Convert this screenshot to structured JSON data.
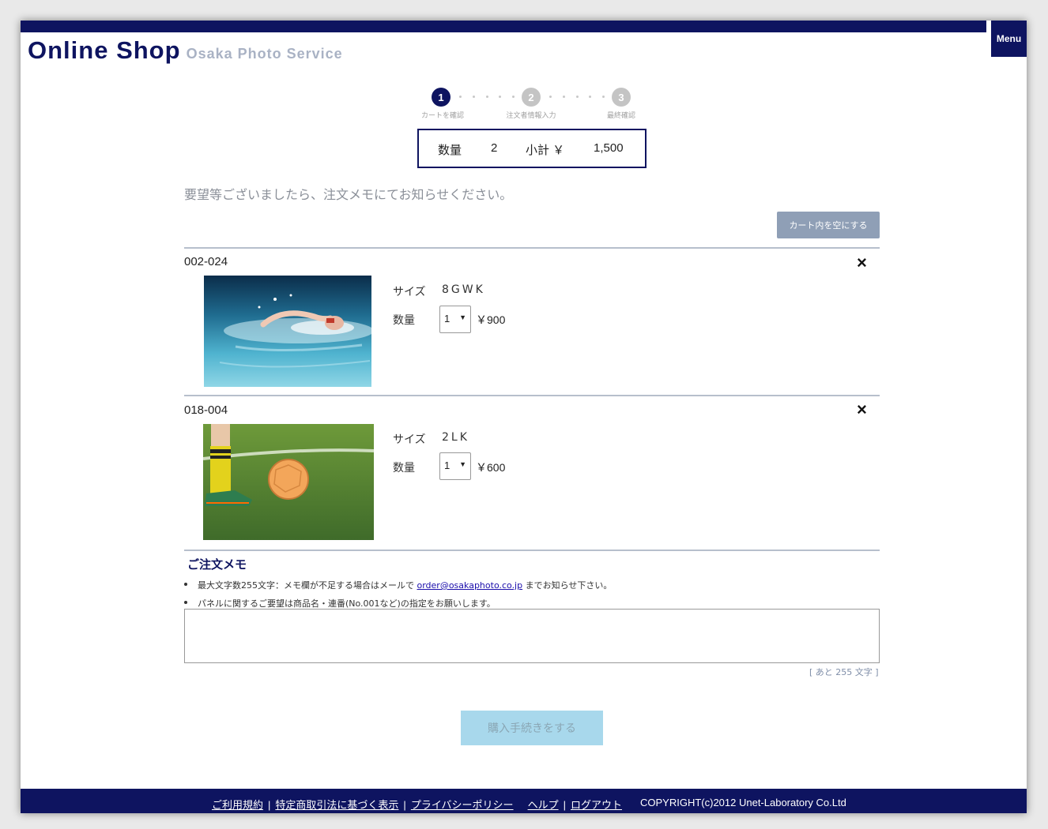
{
  "header": {
    "title": "Online Shop",
    "subtitle": "Osaka Photo Service",
    "menu_label": "Menu"
  },
  "steps": [
    {
      "number": "1",
      "label": "カートを確認",
      "active": true
    },
    {
      "number": "2",
      "label": "注文者情報入力",
      "active": false
    },
    {
      "number": "3",
      "label": "最終確認",
      "active": false
    }
  ],
  "summary": {
    "qty_label": "数量",
    "qty_value": "2",
    "subtotal_label": "小計 ￥",
    "subtotal_value": "1,500"
  },
  "notice": "要望等ございましたら、注文メモにてお知らせください。",
  "empty_cart_label": "カート内を空にする",
  "items": [
    {
      "code": "002-024",
      "size_label": "サイズ",
      "size_value": "8GWK",
      "qty_label": "数量",
      "qty_value": "1",
      "price": "￥900",
      "photo": "swimmer-photo"
    },
    {
      "code": "018-004",
      "size_label": "サイズ",
      "size_value": "2LK",
      "qty_label": "数量",
      "qty_value": "1",
      "price": "￥600",
      "photo": "soccer-ball-photo"
    }
  ],
  "remove_icon": "×",
  "memo": {
    "title": "ご注文メモ",
    "note1_pre": "最大文字数255文字：メモ欄が不足する場合はメールで",
    "note1_email": "order@osakaphoto.co.jp",
    "note1_post": "までお知らせ下さい。",
    "note2": "パネルに関するご要望は商品名・連番(No.001など)の指定をお願いします。",
    "value": "",
    "counter": "[ あと 255 文字 ]"
  },
  "proceed_label": "購入手続きをする",
  "footer": {
    "links": [
      "ご利用規約",
      "特定商取引法に基づく表示",
      "プライバシーポリシー",
      "ヘルプ",
      "ログアウト"
    ],
    "copyright": "COPYRIGHT(c)2012 Unet-Laboratory Co.Ltd"
  },
  "colors": {
    "brand": "#0e1460",
    "subtitle": "#a9b2c4",
    "empty_button": "#8f9fb6",
    "proceed_button": "#a8d8ec"
  }
}
